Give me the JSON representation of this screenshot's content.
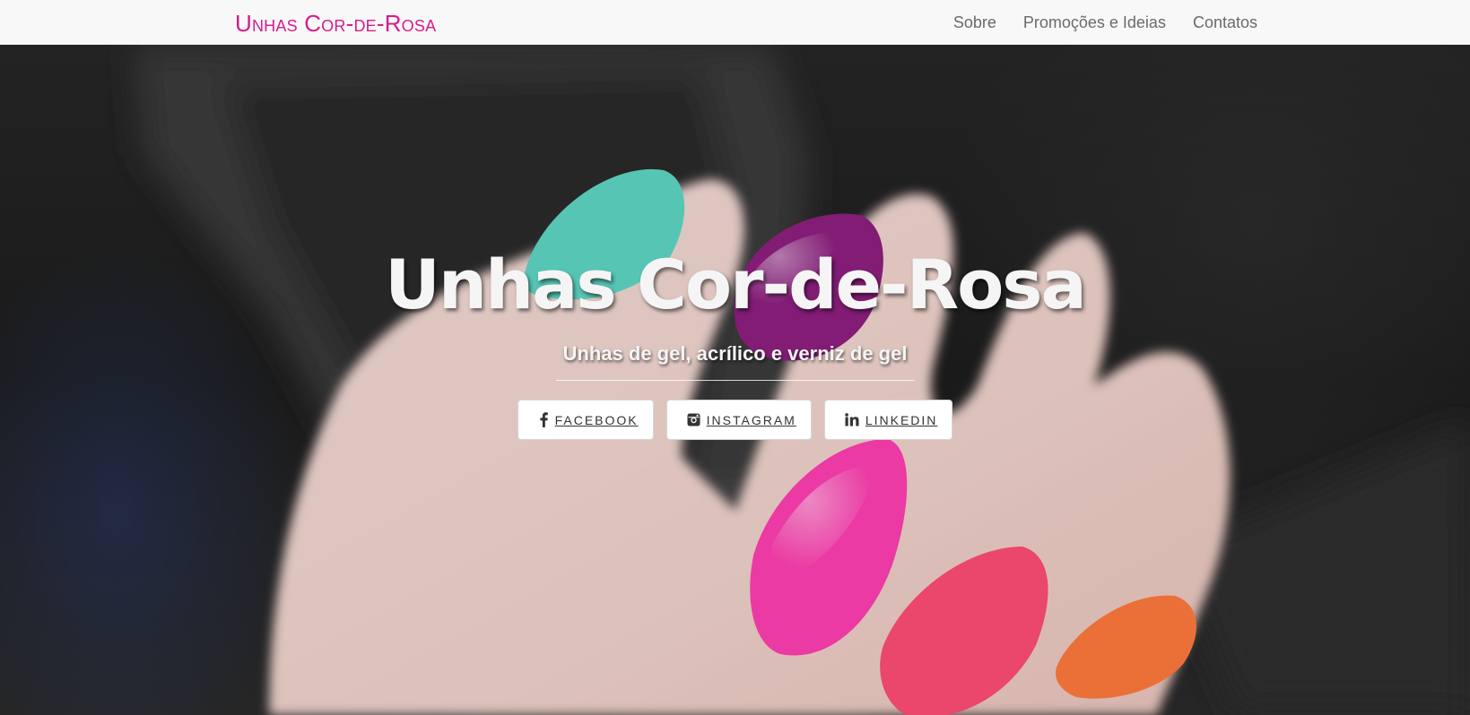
{
  "navbar": {
    "brand": "Unhas Cor-de-Rosa",
    "links": [
      {
        "label": "Sobre"
      },
      {
        "label": "Promoções e Ideias"
      },
      {
        "label": "Contatos"
      }
    ]
  },
  "hero": {
    "title": "Unhas Cor-de-Rosa",
    "subtitle": "Unhas de gel, acrílico e verniz de gel",
    "buttons": [
      {
        "label": "Facebook",
        "icon": "facebook-icon"
      },
      {
        "label": "Instagram",
        "icon": "instagram-icon"
      },
      {
        "label": "Linkedin",
        "icon": "linkedin-icon"
      }
    ]
  },
  "colors": {
    "brand": "#d81b8c",
    "navbar_bg": "#f8f8f8",
    "nav_link": "#6a6a6a",
    "nail_teal": "#5fd6c4",
    "nail_purple": "#8e1f7f",
    "nail_magenta": "#ff3fb1",
    "nail_coral": "#ff4d76",
    "nail_orange": "#ff7a3c"
  }
}
